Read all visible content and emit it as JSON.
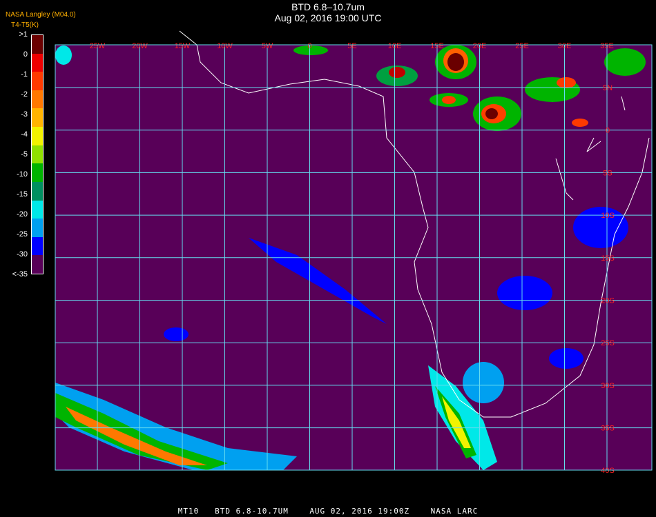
{
  "title": {
    "line1": "BTD 6.8–10.7um",
    "line2": "Aug 02, 2016 19:00 UTC"
  },
  "credit": "NASA Langley (M04.0)",
  "legend": {
    "title": "T4-T5(K)",
    "bins": [
      {
        "label": ">1",
        "color": "#6a0000"
      },
      {
        "label": "0",
        "color": "#ee0000"
      },
      {
        "label": "-1",
        "color": "#ff3a00"
      },
      {
        "label": "-2",
        "color": "#ff7800"
      },
      {
        "label": "-3",
        "color": "#ffb400"
      },
      {
        "label": "-4",
        "color": "#f2f200"
      },
      {
        "label": "-5",
        "color": "#90e000"
      },
      {
        "label": "-10",
        "color": "#00b400"
      },
      {
        "label": "-15",
        "color": "#009060"
      },
      {
        "label": "-20",
        "color": "#00e8e8"
      },
      {
        "label": "-25",
        "color": "#00a0f0"
      },
      {
        "label": "-30",
        "color": "#0000ff"
      },
      {
        "label": "<-35",
        "color": "#580058"
      }
    ]
  },
  "map": {
    "background_color": "#580058",
    "grid_color": "#64dcf0",
    "coast_color": "#ffffff",
    "lon_labels": [
      "25W",
      "20W",
      "15W",
      "10W",
      "5W",
      "0",
      "5E",
      "10E",
      "15E",
      "20E",
      "25E",
      "30E",
      "35E"
    ],
    "lat_labels": [
      "5N",
      "0",
      "5S",
      "10S",
      "15S",
      "20S",
      "25S",
      "30S",
      "35S",
      "40S"
    ],
    "label_color": "#ff2020"
  },
  "footer": "MT10   BTD 6.8-10.7UM    AUG 02, 2016 19:00Z    NASA LARC"
}
